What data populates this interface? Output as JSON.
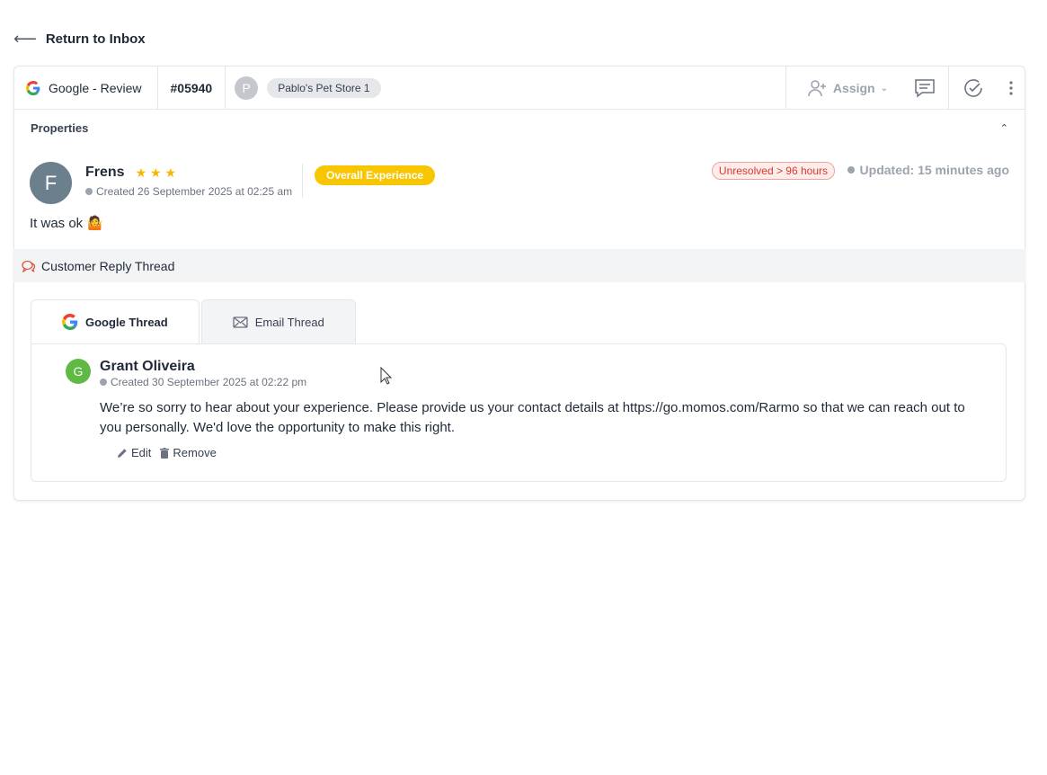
{
  "nav": {
    "back_label": "Return to Inbox"
  },
  "ticket": {
    "source": "Google - Review",
    "id": "#05940",
    "store_initial": "P",
    "store_name": "Pablo's Pet Store 1",
    "assign_label": "Assign"
  },
  "properties": {
    "title": "Properties"
  },
  "review": {
    "reviewer_initial": "F",
    "reviewer_name": "Frens",
    "stars": "★ ★ ★",
    "created": "Created 26 September 2025 at 02:25 am",
    "category_tag": "Overall Experience",
    "sla_tag": "Unresolved > 96 hours",
    "updated": "Updated: 15 minutes ago",
    "text": "It was ok 🤷"
  },
  "thread": {
    "header": "Customer Reply Thread",
    "tabs": [
      {
        "label": "Google Thread",
        "active": true
      },
      {
        "label": "Email Thread",
        "active": false
      }
    ],
    "reply": {
      "author_initial": "G",
      "author": "Grant Oliveira",
      "created": "Created 30 September 2025 at 02:22 pm",
      "text": "We’re so sorry to hear about your experience. Please provide us your contact details at https://go.momos.com/Rarmo so that we can reach out to you personally. We'd love the opportunity to make this right.",
      "edit_label": "Edit",
      "remove_label": "Remove"
    }
  },
  "colors": {
    "star": "#f5b700",
    "category_tag": "#f7c600",
    "sla_tag_text": "#d93a2b",
    "reviewer_avatar": "#6b7f8c",
    "agent_avatar": "#5fb944"
  }
}
